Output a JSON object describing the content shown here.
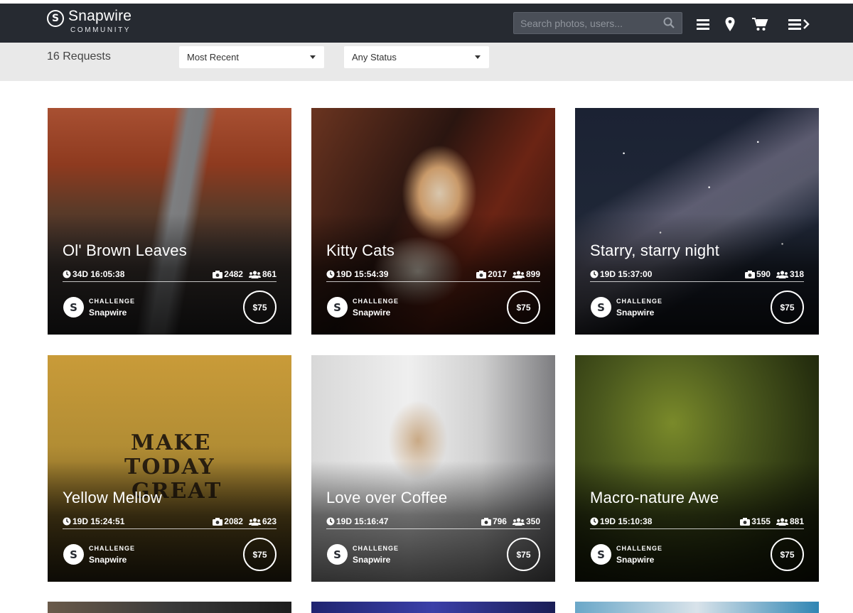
{
  "brand": {
    "name": "Snapwire",
    "sub": "COMMUNITY"
  },
  "search": {
    "placeholder": "Search photos, users..."
  },
  "nav": {
    "icons": [
      "menu-icon",
      "map-pin-icon",
      "cart-icon",
      "menu-arrow-icon"
    ]
  },
  "filters": {
    "count_label": "16 Requests",
    "sort": "Most Recent",
    "status": "Any Status"
  },
  "cards": [
    {
      "title": "Ol' Brown Leaves",
      "time": "34D 16:05:38",
      "photos": "2482",
      "users": "861",
      "type": "CHALLENGE",
      "by": "Snapwire",
      "price": "$75"
    },
    {
      "title": "Kitty Cats",
      "time": "19D 15:54:39",
      "photos": "2017",
      "users": "899",
      "type": "CHALLENGE",
      "by": "Snapwire",
      "price": "$75"
    },
    {
      "title": "Starry, starry night",
      "time": "19D 15:37:00",
      "photos": "590",
      "users": "318",
      "type": "CHALLENGE",
      "by": "Snapwire",
      "price": "$75"
    },
    {
      "title": "Yellow Mellow",
      "time": "19D 15:24:51",
      "photos": "2082",
      "users": "623",
      "type": "CHALLENGE",
      "by": "Snapwire",
      "price": "$75",
      "image_text": [
        "MAKE",
        "TODAY",
        "GREAT"
      ]
    },
    {
      "title": "Love over Coffee",
      "time": "19D 15:16:47",
      "photos": "796",
      "users": "350",
      "type": "CHALLENGE",
      "by": "Snapwire",
      "price": "$75"
    },
    {
      "title": "Macro-nature Awe",
      "time": "19D 15:10:38",
      "photos": "3155",
      "users": "881",
      "type": "CHALLENGE",
      "by": "Snapwire",
      "price": "$75"
    }
  ],
  "colors": {
    "topbar": "#262a31",
    "filterbar": "#e9e9e9",
    "search_bg": "#4a4f58"
  }
}
